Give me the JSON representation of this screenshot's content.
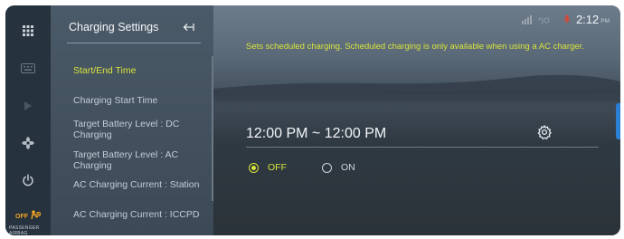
{
  "rail": {
    "icons": [
      "grid-icon",
      "keyboard-icon",
      "play-icon",
      "fan-icon",
      "power-icon",
      "airbag-icon"
    ],
    "airbag": {
      "status": "OFF",
      "label": "PASSENGER AIRBAG"
    }
  },
  "panel": {
    "title": "Charging Settings",
    "items": [
      {
        "label": "Start/End Time",
        "active": true
      },
      {
        "label": "Charging Start Time"
      },
      {
        "label": "Target Battery Level : DC Charging"
      },
      {
        "label": "Target Battery Level : AC Charging"
      },
      {
        "label": "AC Charging Current : Station"
      },
      {
        "label": "AC Charging Current : ICCPD"
      }
    ]
  },
  "status": {
    "time": "2:12",
    "ampm": "PM"
  },
  "main": {
    "info": "Sets scheduled charging. Scheduled charging is only available when using a AC charger.",
    "time_range": "12:00 PM ~ 12:00 PM",
    "options": [
      {
        "label": "OFF",
        "selected": true
      },
      {
        "label": "ON",
        "selected": false
      }
    ]
  },
  "colors": {
    "accent": "#d8e43a",
    "panel": "#4b5a68",
    "rail": "#26323d",
    "edge_tab": "#2a7fd4"
  }
}
